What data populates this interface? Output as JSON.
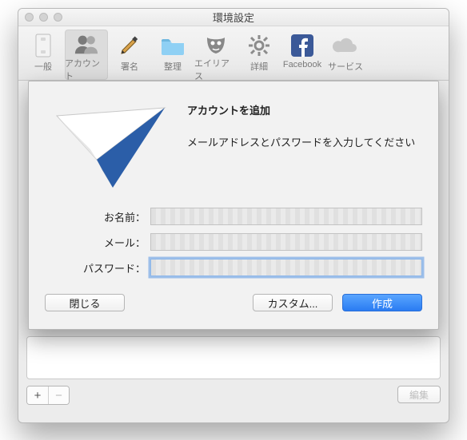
{
  "window": {
    "title": "環境設定"
  },
  "toolbar": {
    "items": [
      {
        "label": "一般"
      },
      {
        "label": "アカウント"
      },
      {
        "label": "署名"
      },
      {
        "label": "整理"
      },
      {
        "label": "エイリアス"
      },
      {
        "label": "詳細"
      },
      {
        "label": "Facebook"
      },
      {
        "label": "サービス"
      }
    ]
  },
  "sheet": {
    "heading": "アカウントを追加",
    "subtext": "メールアドレスとパスワードを入力してください",
    "labels": {
      "name": "お名前：",
      "mail": "メール：",
      "password": "パスワード："
    },
    "values": {
      "name": "",
      "mail": "",
      "password": ""
    },
    "buttons": {
      "close": "閉じる",
      "custom": "カスタム...",
      "create": "作成"
    }
  },
  "footer": {
    "add": "+",
    "remove": "−",
    "edit": "編集"
  }
}
